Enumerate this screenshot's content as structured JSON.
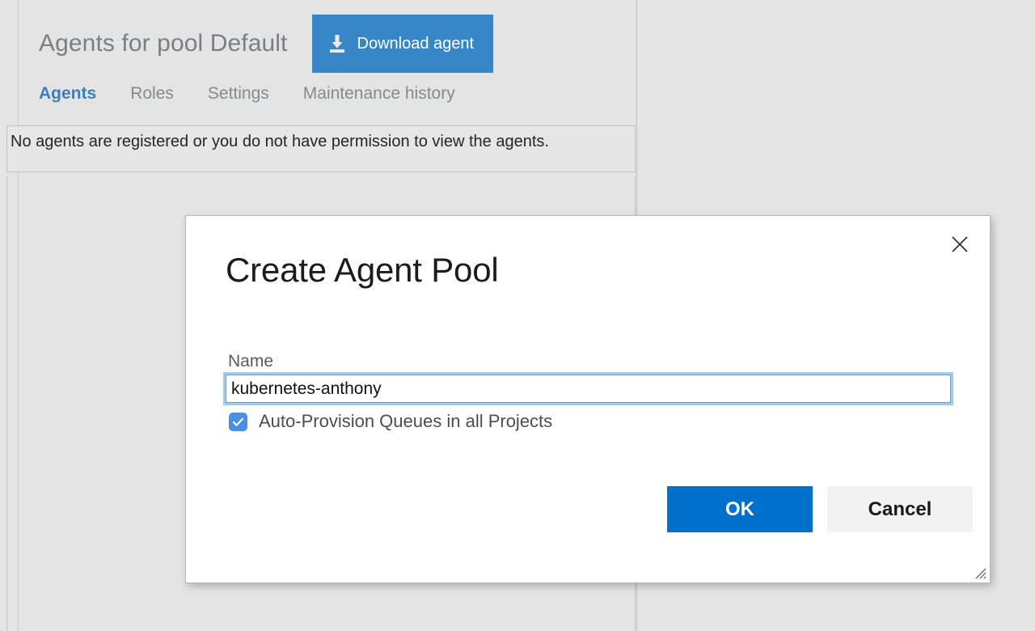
{
  "page": {
    "title": "Agents for pool Default",
    "download_button": {
      "label": "Download agent",
      "icon": "download-icon",
      "color": "#3787c8"
    },
    "tabs": [
      {
        "label": "Agents",
        "active": true
      },
      {
        "label": "Roles",
        "active": false
      },
      {
        "label": "Settings",
        "active": false
      },
      {
        "label": "Maintenance history",
        "active": false
      }
    ],
    "message": "No agents are registered or you do not have permission to view the agents.",
    "accent_color": "#3a7fc1",
    "background_color": "#e4e4e4"
  },
  "dialog": {
    "title": "Create Agent Pool",
    "close_icon": "close-icon",
    "resize_icon": "resize-grip-icon",
    "name_field": {
      "label": "Name",
      "value": "kubernetes-anthony",
      "placeholder": "",
      "focused": true,
      "focus_color": "#5b9fe0"
    },
    "auto_provision": {
      "label": "Auto-Provision Queues in all Projects",
      "checked": true,
      "checkbox_color": "#4a90e2",
      "check_icon": "check-icon"
    },
    "buttons": {
      "ok_label": "OK",
      "ok_color": "#0070cd",
      "cancel_label": "Cancel",
      "cancel_color": "#f2f2f2"
    }
  }
}
